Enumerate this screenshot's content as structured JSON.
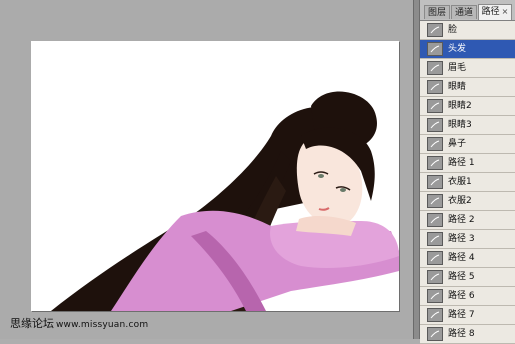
{
  "panel": {
    "tabs": [
      {
        "label": "图层",
        "active": false
      },
      {
        "label": "通道",
        "active": false
      },
      {
        "label": "路径",
        "active": true
      }
    ],
    "close_glyph": "×",
    "paths": [
      {
        "label": "脸",
        "selected": false,
        "icon": "face-path-thumb"
      },
      {
        "label": "头发",
        "selected": true,
        "icon": "hair-path-thumb"
      },
      {
        "label": "眉毛",
        "selected": false,
        "icon": "eyebrow-path-thumb"
      },
      {
        "label": "眼睛",
        "selected": false,
        "icon": "eye-path-thumb"
      },
      {
        "label": "眼睛2",
        "selected": false,
        "icon": "eye-path-thumb"
      },
      {
        "label": "眼睛3",
        "selected": false,
        "icon": "eye-path-thumb"
      },
      {
        "label": "鼻子",
        "selected": false,
        "icon": "nose-path-thumb"
      },
      {
        "label": "路径 1",
        "selected": false,
        "icon": "path-thumb"
      },
      {
        "label": "衣服1",
        "selected": false,
        "icon": "clothes-path-thumb"
      },
      {
        "label": "衣服2",
        "selected": false,
        "icon": "clothes-path-thumb"
      },
      {
        "label": "路径 2",
        "selected": false,
        "icon": "path-thumb"
      },
      {
        "label": "路径 3",
        "selected": false,
        "icon": "path-thumb"
      },
      {
        "label": "路径 4",
        "selected": false,
        "icon": "path-thumb"
      },
      {
        "label": "路径 5",
        "selected": false,
        "icon": "path-thumb"
      },
      {
        "label": "路径 6",
        "selected": false,
        "icon": "path-thumb"
      },
      {
        "label": "路径 7",
        "selected": false,
        "icon": "path-thumb"
      },
      {
        "label": "路径 8",
        "selected": false,
        "icon": "path-thumb"
      }
    ]
  },
  "watermark": {
    "site_name": "思缘论坛",
    "url": "www.missyuan.com"
  },
  "colors": {
    "hair": "#1e110c",
    "clothes": "#d78ed0",
    "clothes_shadow": "#b765ad",
    "skin": "#f9e6dc",
    "selected_row": "#2f59b3"
  }
}
